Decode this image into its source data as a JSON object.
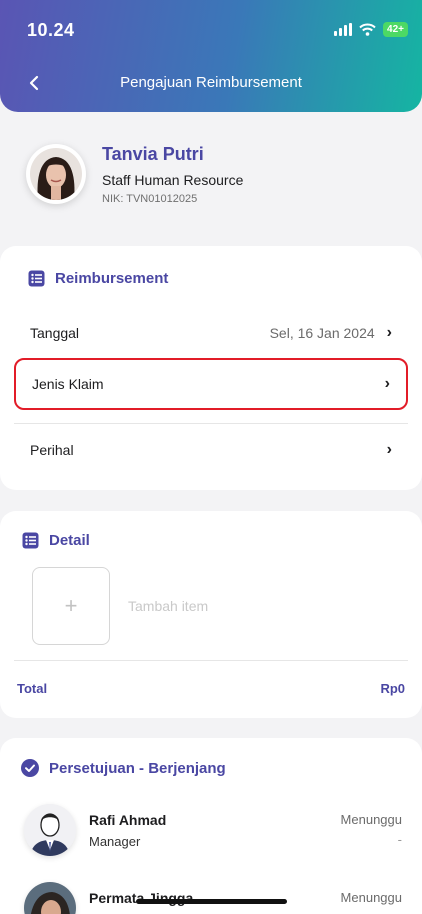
{
  "status_bar": {
    "time": "10.24",
    "battery": "42+"
  },
  "header": {
    "title": "Pengajuan Reimbursement"
  },
  "profile": {
    "name": "Tanvia Putri",
    "role": "Staff Human Resource",
    "nik": "NIK: TVN01012025"
  },
  "reimbursement": {
    "title": "Reimbursement",
    "rows": [
      {
        "label": "Tanggal",
        "value": "Sel, 16 Jan 2024"
      },
      {
        "label": "Jenis Klaim",
        "value": ""
      },
      {
        "label": "Perihal",
        "value": ""
      }
    ]
  },
  "detail": {
    "title": "Detail",
    "add_label": "Tambah item",
    "total_label": "Total",
    "total_value": "Rp0"
  },
  "approval": {
    "title": "Persetujuan - Berjenjang",
    "approvers": [
      {
        "name": "Rafi Ahmad",
        "role": "Manager",
        "status": "Menunggu",
        "date": "-"
      },
      {
        "name": "Permata Jingga",
        "role": "",
        "status": "Menunggu",
        "date": ""
      }
    ]
  },
  "colors": {
    "accent": "#4a47a3",
    "highlight": "#e21c28",
    "header_start": "#5a55b4",
    "header_end": "#15b5a2"
  }
}
